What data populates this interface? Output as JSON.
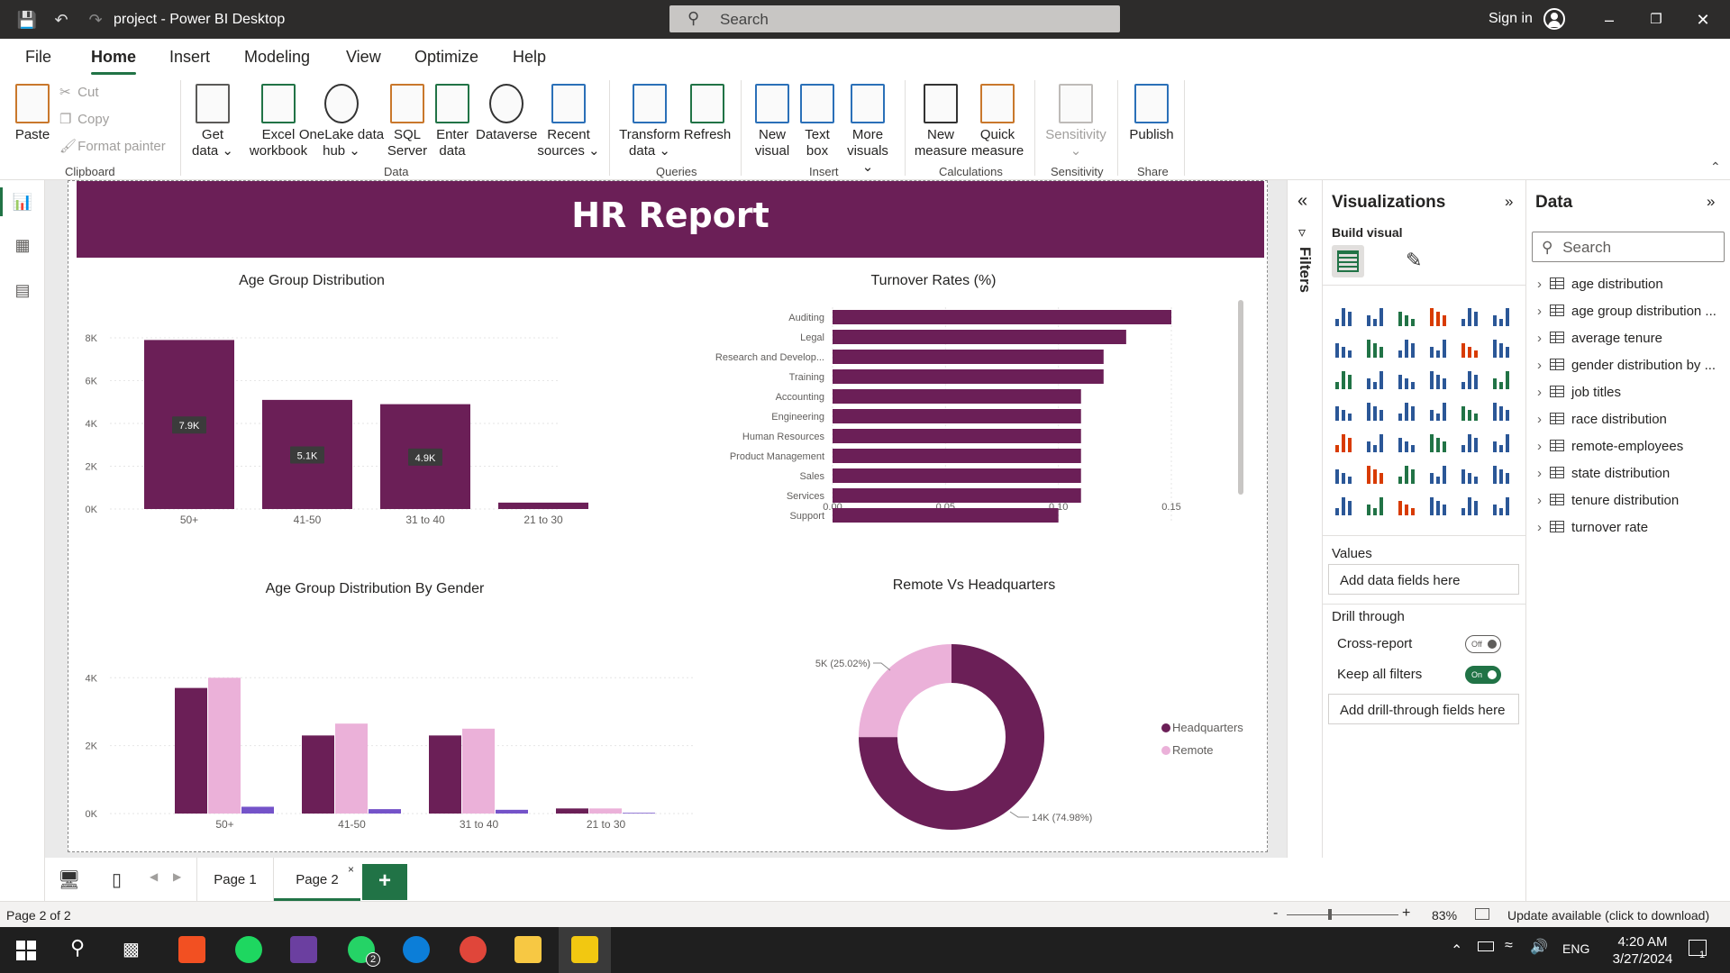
{
  "titlebar": {
    "app_title": "project - Power BI Desktop",
    "search_placeholder": "Search",
    "signin": "Sign in"
  },
  "menu": {
    "tabs": [
      "File",
      "Home",
      "Insert",
      "Modeling",
      "View",
      "Optimize",
      "Help"
    ],
    "active": "Home"
  },
  "ribbon": {
    "paste": "Paste",
    "cut": "Cut",
    "copy": "Copy",
    "format_painter": "Format painter",
    "clipboard_group": "Clipboard",
    "get_data": [
      "Get",
      "data"
    ],
    "excel": [
      "Excel",
      "workbook"
    ],
    "onelake": [
      "OneLake data",
      "hub"
    ],
    "sql": [
      "SQL",
      "Server"
    ],
    "enter_data": [
      "Enter",
      "data"
    ],
    "dataverse": "Dataverse",
    "recent": [
      "Recent",
      "sources"
    ],
    "data_group": "Data",
    "transform": [
      "Transform",
      "data"
    ],
    "refresh": "Refresh",
    "queries_group": "Queries",
    "new_visual": [
      "New",
      "visual"
    ],
    "text_box": [
      "Text",
      "box"
    ],
    "more_visuals": [
      "More",
      "visuals"
    ],
    "insert_group": "Insert",
    "new_measure": [
      "New",
      "measure"
    ],
    "quick_measure": [
      "Quick",
      "measure"
    ],
    "calc_group": "Calculations",
    "sensitivity": "Sensitivity",
    "sensitivity_group": "Sensitivity",
    "publish": "Publish",
    "share_group": "Share"
  },
  "report": {
    "title": "HR Report"
  },
  "colors": {
    "primary": "#6b1f57",
    "secondary": "#ebb1d9",
    "tertiary": "#7453c9",
    "accent": "#217346"
  },
  "chart_data": [
    {
      "type": "bar",
      "title": "Age Group Distribution",
      "categories": [
        "50+",
        "41-50",
        "31 to 40",
        "21 to 30"
      ],
      "values": [
        7900,
        5100,
        4900,
        300
      ],
      "data_labels": [
        "7.9K",
        "5.1K",
        "4.9K",
        ""
      ],
      "yticks": [
        "0K",
        "2K",
        "4K",
        "6K",
        "8K"
      ],
      "ylim": [
        0,
        8000
      ]
    },
    {
      "type": "bar",
      "orientation": "horizontal",
      "title": "Turnover Rates (%)",
      "categories": [
        "Auditing",
        "Legal",
        "Research and Develop...",
        "Training",
        "Accounting",
        "Engineering",
        "Human Resources",
        "Product Management",
        "Sales",
        "Services",
        "Support"
      ],
      "values": [
        0.15,
        0.13,
        0.12,
        0.12,
        0.11,
        0.11,
        0.11,
        0.11,
        0.11,
        0.11,
        0.1
      ],
      "xticks": [
        "0.00",
        "0.05",
        "0.10",
        "0.15"
      ],
      "xlim": [
        0,
        0.15
      ]
    },
    {
      "type": "bar",
      "title": "Age Group Distribution By Gender",
      "categories": [
        "50+",
        "41-50",
        "31 to 40",
        "21 to 30"
      ],
      "series": [
        {
          "values": [
            3700,
            2300,
            2300,
            150
          ]
        },
        {
          "values": [
            4000,
            2650,
            2500,
            150
          ]
        },
        {
          "values": [
            200,
            130,
            110,
            20
          ]
        }
      ],
      "yticks": [
        "0K",
        "2K",
        "4K"
      ],
      "ylim": [
        0,
        4300
      ]
    },
    {
      "type": "pie",
      "title": "Remote Vs Headquarters",
      "slices": [
        {
          "name": "Headquarters",
          "value": 74.98,
          "label": "14K (74.98%)"
        },
        {
          "name": "Remote",
          "value": 25.02,
          "label": "5K (25.02%)"
        }
      ],
      "legend": [
        "Headquarters",
        "Remote"
      ]
    }
  ],
  "filters": {
    "label": "Filters"
  },
  "viz_pane": {
    "title": "Visualizations",
    "build_visual": "Build visual",
    "values": "Values",
    "add_fields": "Add data fields here",
    "drill_through": "Drill through",
    "cross_report": "Cross-report",
    "cross_report_state": "Off",
    "keep_filters": "Keep all filters",
    "keep_filters_state": "On",
    "add_drill": "Add drill-through fields here"
  },
  "data_pane": {
    "title": "Data",
    "search_placeholder": "Search",
    "tables": [
      "age distribution",
      "age group distribution ...",
      "average tenure",
      "gender distribution by ...",
      "job titles",
      "race distribution",
      "remote-employees",
      "state distribution",
      "tenure distribution",
      "turnover rate"
    ]
  },
  "pages": {
    "tabs": [
      "Page 1",
      "Page 2"
    ],
    "active": "Page 2",
    "add": "+"
  },
  "status": {
    "page": "Page 2 of 2",
    "zoom": "83%",
    "update": "Update available (click to download)"
  },
  "taskbar": {
    "time": "4:20 AM",
    "date": "3/27/2024",
    "lang": "ENG",
    "whatsapp_badge": "2",
    "notif_badge": "1"
  }
}
